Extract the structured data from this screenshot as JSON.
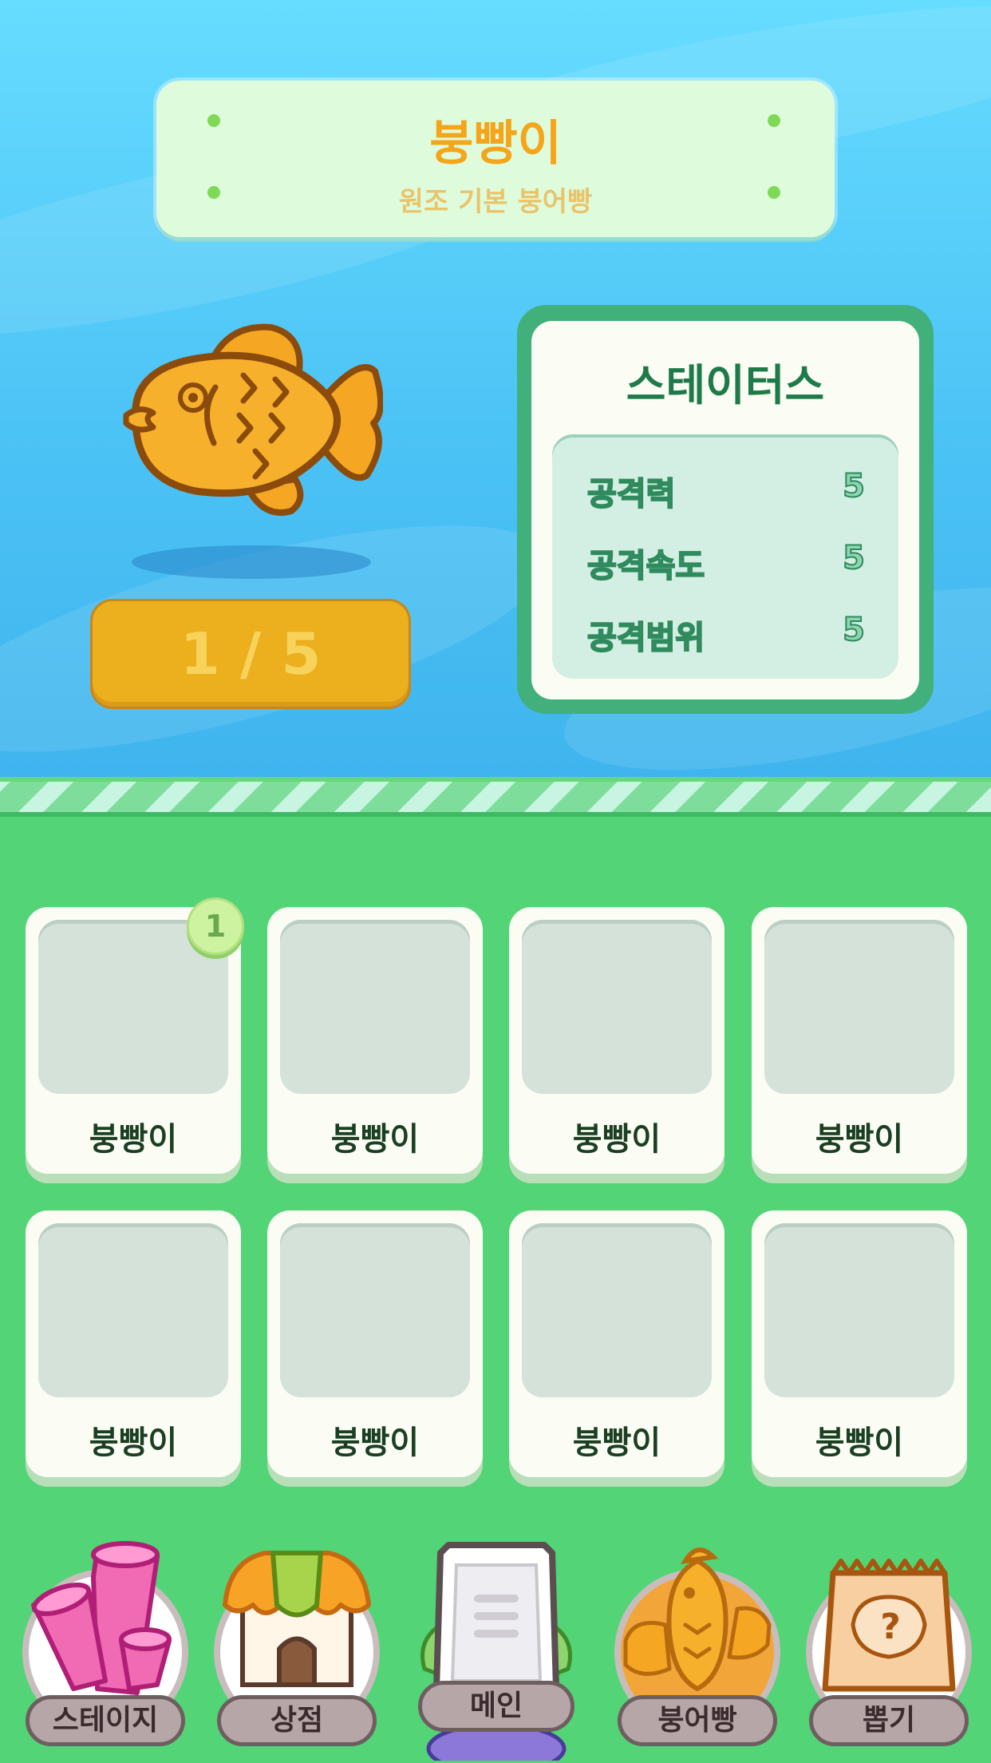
{
  "header": {
    "title": "붕빵이",
    "subtitle": "원조 기본 붕어빵"
  },
  "character": {
    "icon": "taiyaki-fish-icon",
    "count_label": "1 / 5"
  },
  "stats": {
    "title": "스테이터스",
    "rows": [
      {
        "label": "공격력",
        "value": "5"
      },
      {
        "label": "공격속도",
        "value": "5"
      },
      {
        "label": "공격범위",
        "value": "5"
      }
    ]
  },
  "collection": {
    "cards": [
      {
        "name": "붕빵이",
        "badge": "1"
      },
      {
        "name": "붕빵이"
      },
      {
        "name": "붕빵이"
      },
      {
        "name": "붕빵이"
      },
      {
        "name": "붕빵이"
      },
      {
        "name": "붕빵이"
      },
      {
        "name": "붕빵이"
      },
      {
        "name": "붕빵이"
      }
    ]
  },
  "nav": {
    "items": [
      {
        "label": "스테이지",
        "icon": "coral-icon"
      },
      {
        "label": "상점",
        "icon": "shop-icon"
      },
      {
        "label": "메인",
        "icon": "document-icon"
      },
      {
        "label": "붕어빵",
        "icon": "taiyaki-icon",
        "active": true
      },
      {
        "label": "뽑기",
        "icon": "gacha-bag-icon"
      }
    ]
  },
  "colors": {
    "sky": "#4cc3f5",
    "accent_gold": "#ecaf1d",
    "grass": "#52d477",
    "stats_green": "#41b07b"
  }
}
